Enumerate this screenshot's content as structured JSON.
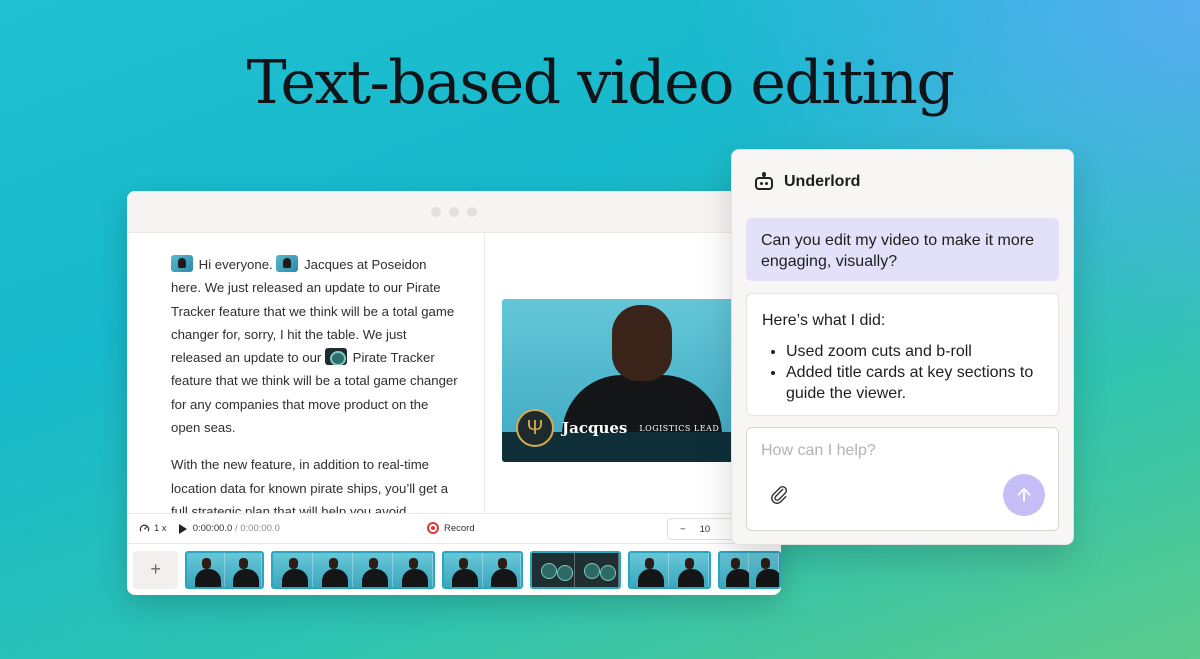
{
  "headline": "Text-based video editing",
  "editor": {
    "script_paragraphs": [
      {
        "parts": [
          "Hi everyone.",
          "Jacques at Poseidon here. We just released an update to our Pirate Tracker feature that we think will be a total game changer for, sorry, I hit the table. We just released an update to our",
          "Pirate Tracker feature that we think will be a total game changer for any companies that move product on the open seas."
        ]
      },
      {
        "text": "With the new feature, in addition to real-time location data for known pirate ships, you’ll get a full strategic plan that will help you avoid"
      }
    ],
    "preview": {
      "lower_third_name": "Jacques",
      "lower_third_role": "LOGISTICS LEAD"
    },
    "transport": {
      "speed": "1 x",
      "current_time": "0:00:00.0",
      "separator": "/",
      "total_time": "0:00:00.0",
      "record_label": "Record",
      "zoom_minus": "−",
      "zoom_value": "10"
    },
    "timeline": {
      "add_label": "+"
    }
  },
  "underlord": {
    "title": "Underlord",
    "user_message": "Can you edit my video to make it more engaging, visually?",
    "reply_intro": "Here’s what I did:",
    "reply_items": [
      "Used zoom cuts and b-roll",
      "Added title cards at key sections to guide the viewer."
    ],
    "composer_placeholder": "How can I help?"
  },
  "colors": {
    "accent_purple": "#c6bff7",
    "user_bubble": "#e3e0fa",
    "record_red": "#e23838"
  }
}
